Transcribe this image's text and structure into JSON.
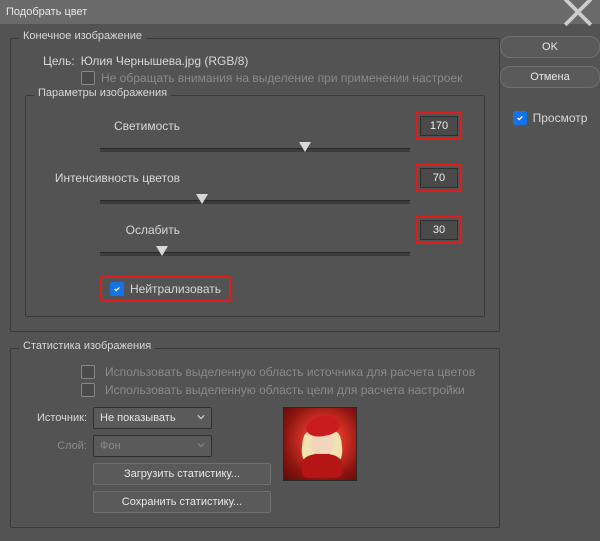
{
  "window": {
    "title": "Подобрать цвет"
  },
  "side": {
    "ok": "OK",
    "cancel": "Отмена",
    "preview_label": "Просмотр",
    "preview_checked": true
  },
  "dest": {
    "group_title": "Конечное изображение",
    "target_label": "Цель:",
    "target_value": "Юлия Чернышева.jpg (RGB/8)",
    "ignore_label": "Не обращать внимания на выделение при применении настроек",
    "ignore_checked": false
  },
  "params": {
    "group_title": "Параметры изображения",
    "rows": [
      {
        "label": "Светимость",
        "value": "170",
        "pos": 66
      },
      {
        "label": "Интенсивность цветов",
        "value": "70",
        "pos": 33
      },
      {
        "label": "Ослабить",
        "value": "30",
        "pos": 20
      }
    ],
    "neutralize_label": "Нейтрализовать",
    "neutralize_checked": true
  },
  "stats": {
    "group_title": "Статистика изображения",
    "use_src_sel_label": "Использовать выделенную область источника для расчета цветов",
    "use_dst_sel_label": "Использовать выделенную область цели для расчета настройки",
    "source_label": "Источник:",
    "source_value": "Не показывать",
    "layer_label": "Слой:",
    "layer_value": "Фон",
    "load_btn": "Загрузить статистику...",
    "save_btn": "Сохранить статистику..."
  }
}
